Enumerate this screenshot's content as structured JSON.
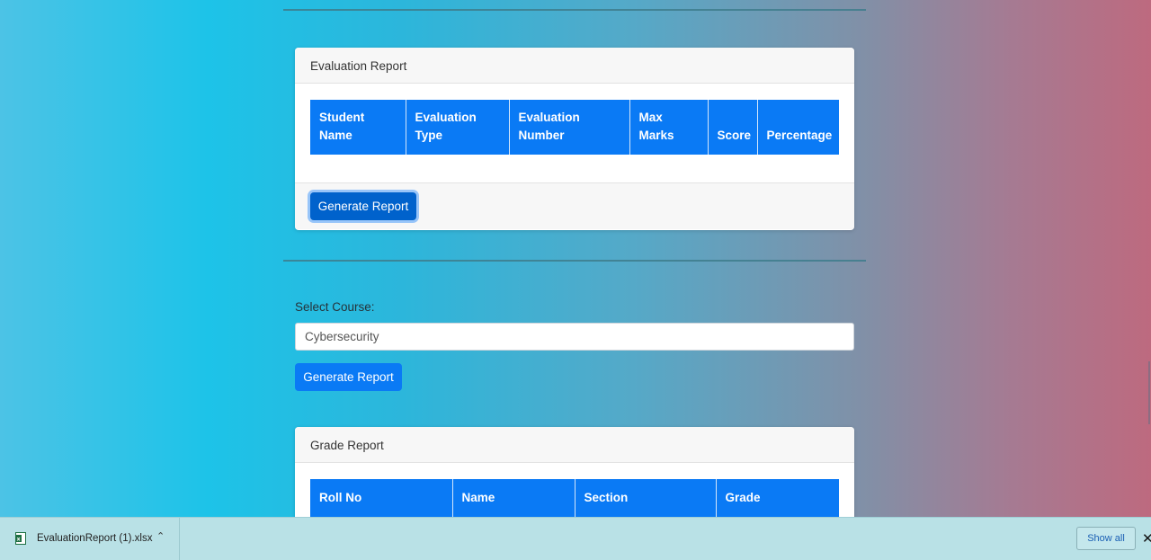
{
  "evaluation_report": {
    "title": "Evaluation Report",
    "columns": [
      {
        "line1": "Student",
        "line2": "Name"
      },
      {
        "line1": "Evaluation",
        "line2": "Type"
      },
      {
        "line1": "Evaluation",
        "line2": "Number"
      },
      {
        "line1": "Max",
        "line2": "Marks"
      },
      {
        "line1": "",
        "line2": "Score"
      },
      {
        "line1": "",
        "line2": "Percentage"
      }
    ],
    "generate_button": "Generate Report"
  },
  "course_select": {
    "label": "Select Course:",
    "value": "Cybersecurity",
    "generate_button": "Generate Report"
  },
  "grade_report": {
    "title": "Grade Report",
    "columns": [
      "Roll No",
      "Name",
      "Section",
      "Grade"
    ]
  },
  "download_bar": {
    "file_name": "EvaluationReport (1).xlsx",
    "file_icon": "excel-file-icon",
    "show_all": "Show all",
    "close_symbol": "✕"
  },
  "colors": {
    "primary": "#0a7af5",
    "primary_focused": "#0062cc",
    "download_bar": "#b9e1e6"
  }
}
